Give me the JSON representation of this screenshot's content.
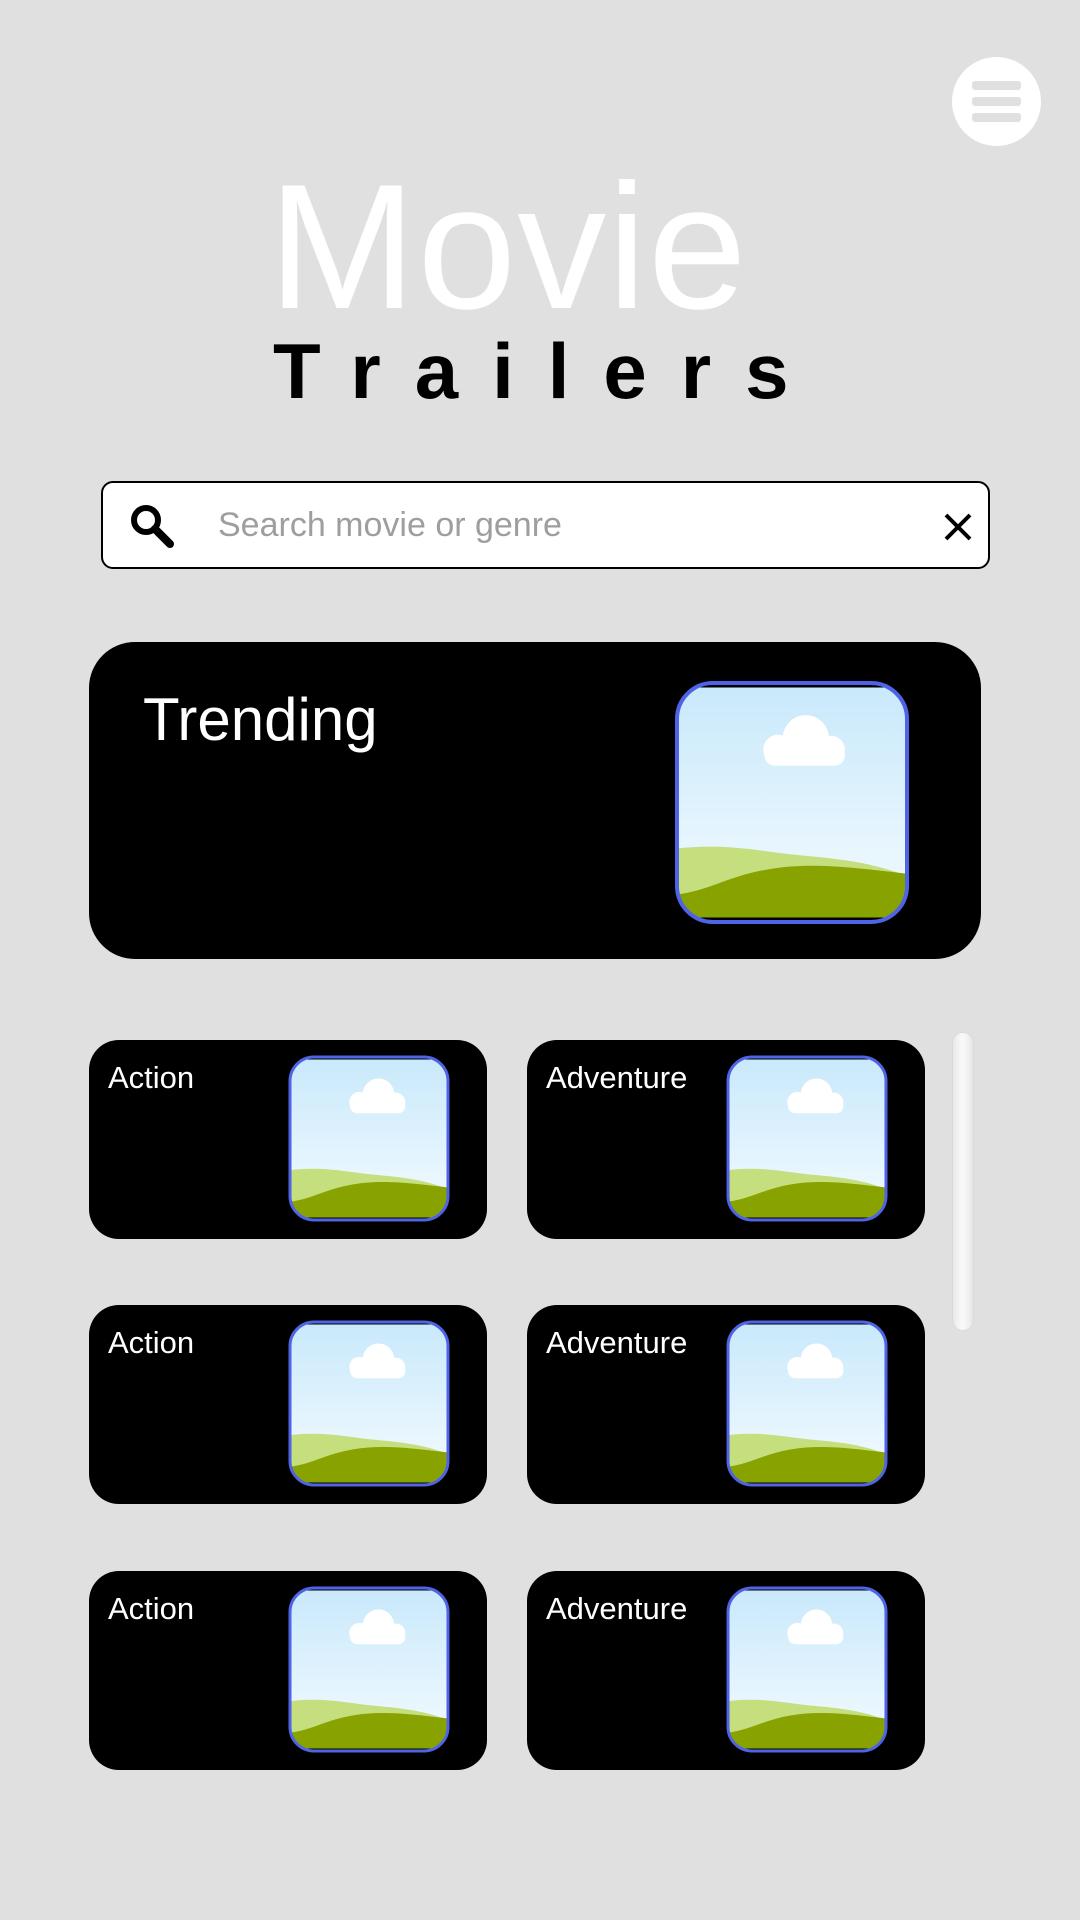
{
  "header": {
    "title": "Movie",
    "subtitle": "Trailers",
    "menu_icon": "hamburger-menu-icon"
  },
  "search": {
    "placeholder": "Search movie or genre",
    "value": "",
    "search_icon": "search-icon",
    "clear_icon": "close-icon"
  },
  "trending": {
    "label": "Trending",
    "thumbnail_icon": "image-placeholder-icon"
  },
  "genres": [
    {
      "label": "Action"
    },
    {
      "label": "Adventure"
    },
    {
      "label": "Action"
    },
    {
      "label": "Adventure"
    },
    {
      "label": "Action"
    },
    {
      "label": "Adventure"
    }
  ],
  "colors": {
    "background": "#e0e0e0",
    "card": "#000000",
    "thumbnail_border": "#4f63e6",
    "sky_top": "#c9e9fb",
    "grass_light": "#c5de7e",
    "grass_dark": "#88a300"
  }
}
